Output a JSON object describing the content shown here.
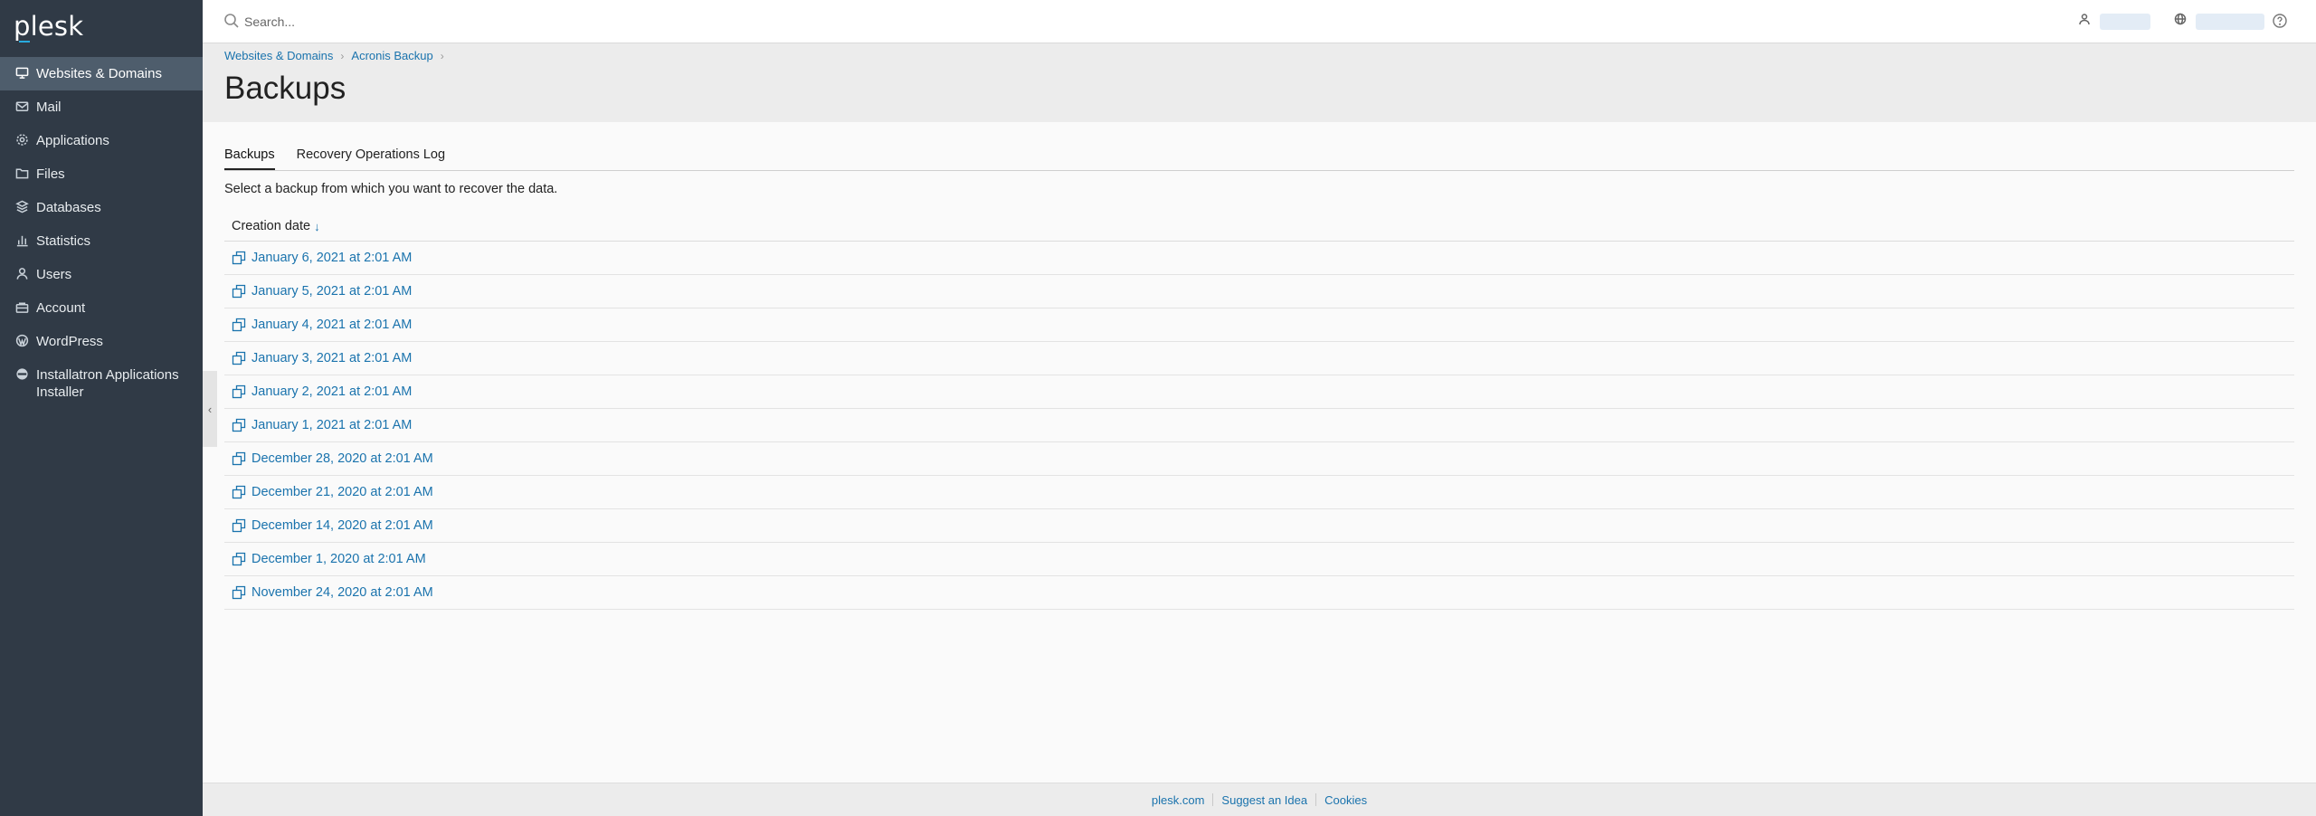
{
  "sidebar": {
    "logo": "plesk",
    "items": [
      {
        "label": "Websites & Domains",
        "icon": "monitor-icon",
        "active": true
      },
      {
        "label": "Mail",
        "icon": "mail-icon"
      },
      {
        "label": "Applications",
        "icon": "gear-icon"
      },
      {
        "label": "Files",
        "icon": "folder-icon"
      },
      {
        "label": "Databases",
        "icon": "database-icon"
      },
      {
        "label": "Statistics",
        "icon": "bar-chart-icon"
      },
      {
        "label": "Users",
        "icon": "user-icon"
      },
      {
        "label": "Account",
        "icon": "account-icon"
      },
      {
        "label": "WordPress",
        "icon": "wordpress-icon"
      },
      {
        "label": "Installatron Applications Installer",
        "icon": "installatron-icon"
      }
    ]
  },
  "topbar": {
    "search_placeholder": "Search..."
  },
  "breadcrumb": [
    "Websites & Domains",
    "Acronis Backup"
  ],
  "page": {
    "title": "Backups"
  },
  "tabs": [
    {
      "label": "Backups",
      "active": true
    },
    {
      "label": "Recovery Operations Log",
      "active": false
    }
  ],
  "intro": "Select a backup from which you want to recover the data.",
  "table": {
    "column": "Creation date",
    "sort_indicator": "↓",
    "rows": [
      "January 6, 2021 at 2:01 AM",
      "January 5, 2021 at 2:01 AM",
      "January 4, 2021 at 2:01 AM",
      "January 3, 2021 at 2:01 AM",
      "January 2, 2021 at 2:01 AM",
      "January 1, 2021 at 2:01 AM",
      "December 28, 2020 at 2:01 AM",
      "December 21, 2020 at 2:01 AM",
      "December 14, 2020 at 2:01 AM",
      "December 1, 2020 at 2:01 AM",
      "November 24, 2020 at 2:01 AM"
    ]
  },
  "footer": {
    "links": [
      "plesk.com",
      "Suggest an Idea",
      "Cookies"
    ]
  },
  "colors": {
    "sidebar_bg": "#303a46",
    "sidebar_active": "#4e5d6c",
    "link": "#1a73ad",
    "accent": "#28aade"
  }
}
